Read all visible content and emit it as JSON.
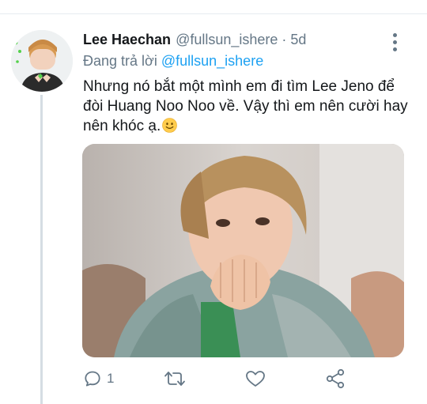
{
  "tweet": {
    "author_name": "Lee Haechan",
    "author_handle": "@fullsun_ishere",
    "separator": "·",
    "time": "5d",
    "reply_prefix": "Đang trả lời",
    "reply_to": "@fullsun_ishere",
    "text": "Nhưng nó bắt một mình em đi tìm Lee Jeno để đòi Huang Noo Noo về. Vậy thì em nên cười hay nên khóc ạ.",
    "emoji": "slightly-smiling-face"
  },
  "actions": {
    "reply_count": "1",
    "icons": [
      "reply-icon",
      "retweet-icon",
      "like-icon",
      "share-icon"
    ]
  },
  "colors": {
    "link": "#1da1f2",
    "muted": "#657786",
    "text": "#14171a"
  }
}
